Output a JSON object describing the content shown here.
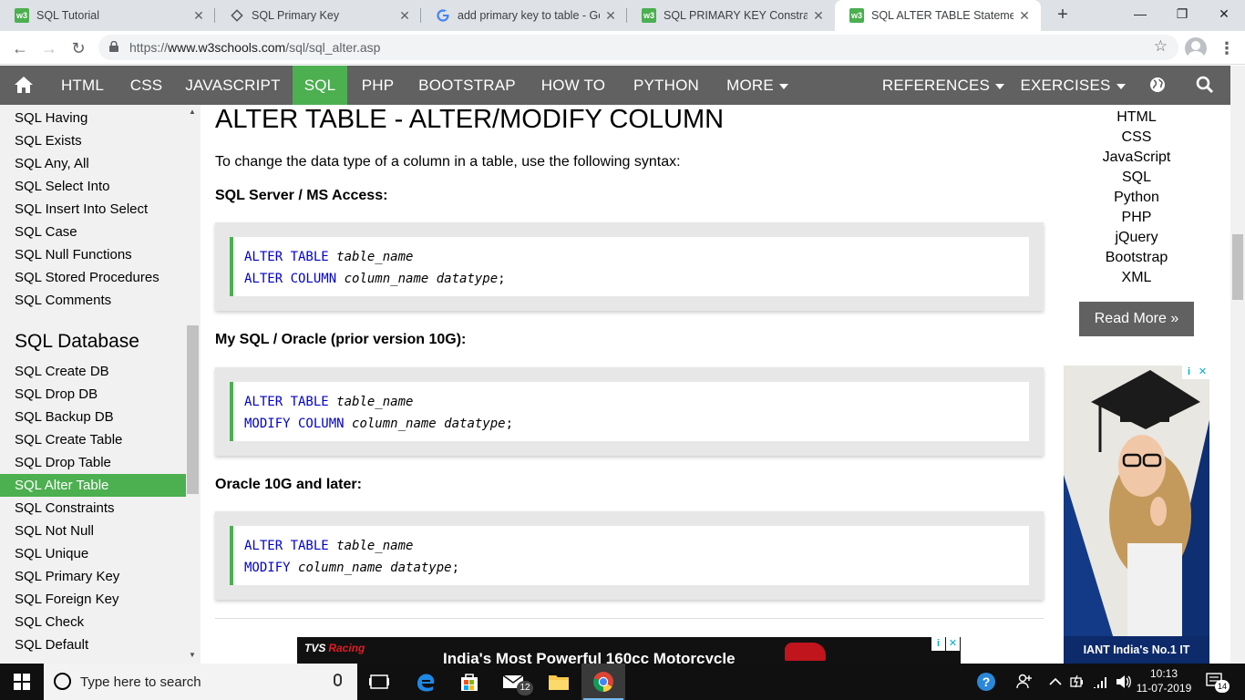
{
  "browser": {
    "tabs": [
      {
        "title": "SQL Tutorial",
        "favicon": "w3"
      },
      {
        "title": "SQL Primary Key",
        "favicon": "diamond"
      },
      {
        "title": "add primary key to table - Goo",
        "favicon": "google"
      },
      {
        "title": "SQL PRIMARY KEY Constraint",
        "favicon": "w3"
      },
      {
        "title": "SQL ALTER TABLE Statement",
        "favicon": "w3",
        "active": true
      }
    ],
    "url_scheme": "https://",
    "url_host": "www.w3schools.com",
    "url_path": "/sql/sql_alter.asp"
  },
  "nav": {
    "items": [
      "HTML",
      "CSS",
      "JAVASCRIPT",
      "SQL",
      "PHP",
      "BOOTSTRAP",
      "HOW TO",
      "PYTHON",
      "MORE"
    ],
    "references": "REFERENCES",
    "exercises": "EXERCISES",
    "active": "SQL",
    "accent": "#4CAF50"
  },
  "sidebar": {
    "links_top": [
      "SQL Having",
      "SQL Exists",
      "SQL Any, All",
      "SQL Select Into",
      "SQL Insert Into Select",
      "SQL Case",
      "SQL Null Functions",
      "SQL Stored Procedures",
      "SQL Comments"
    ],
    "heading": "SQL Database",
    "links_db": [
      "SQL Create DB",
      "SQL Drop DB",
      "SQL Backup DB",
      "SQL Create Table",
      "SQL Drop Table",
      "SQL Alter Table",
      "SQL Constraints",
      "SQL Not Null",
      "SQL Unique",
      "SQL Primary Key",
      "SQL Foreign Key",
      "SQL Check",
      "SQL Default"
    ],
    "active": "SQL Alter Table"
  },
  "main": {
    "title": "ALTER TABLE - ALTER/MODIFY COLUMN",
    "intro": "To change the data type of a column in a table, use the following syntax:",
    "sections": [
      {
        "heading": "SQL Server / MS Access:",
        "line1_kw": "ALTER TABLE",
        "line1_arg": "table_name",
        "line2_kw": "ALTER COLUMN",
        "line2_arg": "column_name datatype",
        "terminator": ";"
      },
      {
        "heading": "My SQL / Oracle (prior version 10G):",
        "line1_kw": "ALTER TABLE",
        "line1_arg": "table_name",
        "line2_kw": "MODIFY COLUMN",
        "line2_arg": "column_name datatype",
        "terminator": ";"
      },
      {
        "heading": "Oracle 10G and later:",
        "line1_kw": "ALTER TABLE",
        "line1_arg": "table_name",
        "line2_kw": "MODIFY",
        "line2_arg": "column_name datatype",
        "terminator": ";"
      }
    ],
    "bottom_ad_brand": "TVS",
    "bottom_ad_brand_sub": "Racing",
    "bottom_ad_text": "India's Most Powerful 160cc Motorcycle"
  },
  "right": {
    "links": [
      "HTML",
      "CSS",
      "JavaScript",
      "SQL",
      "Python",
      "PHP",
      "jQuery",
      "Bootstrap",
      "XML"
    ],
    "read_more": "Read More »",
    "ad_banner": "IANT India's No.1 IT"
  },
  "taskbar": {
    "search_placeholder": "Type here to search",
    "mail_badge": "12",
    "time": "10:13",
    "date": "11-07-2019",
    "notification_count": "14"
  }
}
